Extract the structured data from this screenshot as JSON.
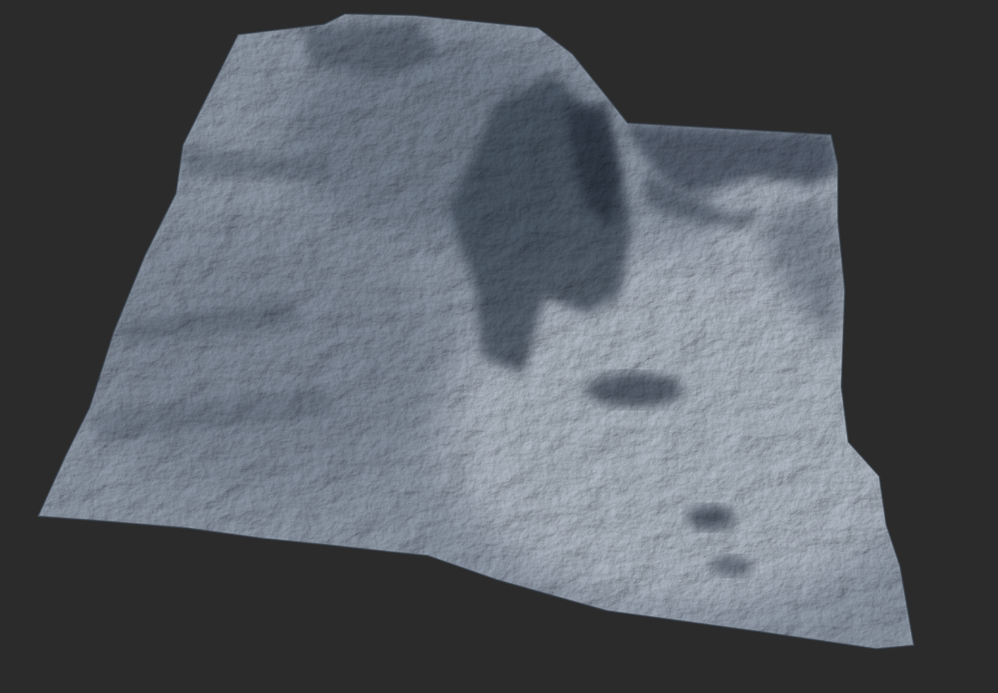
{
  "viewport": {
    "background": "#2b2b2b"
  },
  "terrain": {
    "subject": "3d-terrain-heightmap-render",
    "colors": {
      "highlight": "#c9cfd6",
      "midtone": "#9aa3ae",
      "shade": "#5f6a77",
      "deep_shadow": "#3e4854",
      "cliff_dark": "#2f3742"
    }
  }
}
